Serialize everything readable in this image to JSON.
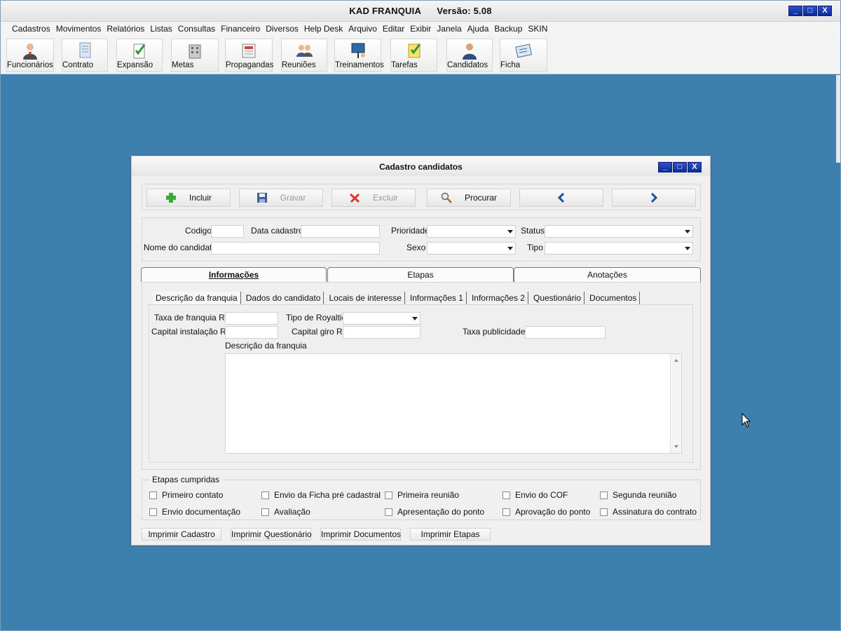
{
  "app": {
    "title": "KAD FRANQUIA      Versão: 5.08",
    "window_buttons": [
      "_",
      "□",
      "X"
    ]
  },
  "menu": [
    "Cadastros",
    "Movimentos",
    "Relatórios",
    "Listas",
    "Consultas",
    "Financeiro",
    "Diversos",
    "Help Desk",
    "Arquivo",
    "Editar",
    "Exibir",
    "Janela",
    "Ajuda",
    "Backup",
    "SKIN"
  ],
  "toolbar": [
    {
      "label": "Funcionários",
      "icon": "person-icon"
    },
    {
      "label": "Contrato",
      "icon": "document-icon"
    },
    {
      "label": "Expansão",
      "icon": "checklist-icon"
    },
    {
      "label": "Metas",
      "icon": "building-icon"
    },
    {
      "label": "Propagandas",
      "icon": "newspaper-icon"
    },
    {
      "label": "Reuniões",
      "icon": "people-icon"
    },
    {
      "label": "Treinamentos",
      "icon": "presentation-icon"
    },
    {
      "label": "Tarefas",
      "icon": "notepad-icon"
    },
    {
      "label": "Candidatos",
      "icon": "candidate-icon"
    },
    {
      "label": "Ficha",
      "icon": "card-icon"
    }
  ],
  "dialog": {
    "title": "Cadastro candidatos",
    "actions": {
      "incluir": "Incluir",
      "gravar": "Gravar",
      "excluir": "Excluir",
      "procurar": "Procurar"
    },
    "form": {
      "codigo_label": "Codigo",
      "data_cadastro_label": "Data cadastro",
      "prioridade_label": "Prioridade",
      "status_label": "Status",
      "nome_label": "Nome do candidato",
      "sexo_label": "Sexo",
      "tipo_label": "Tipo"
    },
    "main_tabs": [
      "Informações",
      "Etapas",
      "Anotações"
    ],
    "sub_tabs": [
      "Descrição da franquia",
      "Dados do candidato",
      "Locais de interesse",
      "Informações 1",
      "Informações 2",
      "Questionário",
      "Documentos"
    ],
    "franquia": {
      "taxa_label": "Taxa de franquia R$",
      "tipo_royaltie_label": "Tipo de Royaltie",
      "capital_instalacao_label": "Capital instalação R$",
      "capital_giro_label": "Capital giro R$",
      "taxa_publicidade_label": "Taxa publicidade",
      "descricao_label": "Descrição da franquia"
    },
    "etapas_group": {
      "legend": "Etapas cumpridas",
      "items": [
        "Primeiro contato",
        "Envio da Ficha pré cadastral",
        "Primeira reunião",
        "Envio do COF",
        "Segunda reunião",
        "Envio documentação",
        "Avaliação",
        "Apresentação do ponto",
        "Aprovação do ponto",
        "Assinatura do contrato"
      ]
    },
    "print_buttons": [
      "Imprimir Cadastro",
      "Imprimir Questionário",
      "Imprimir Documentos",
      "Imprimir Etapas"
    ]
  },
  "colors": {
    "desktop": "#3d80ad",
    "title_button": "#0d2a9e"
  }
}
